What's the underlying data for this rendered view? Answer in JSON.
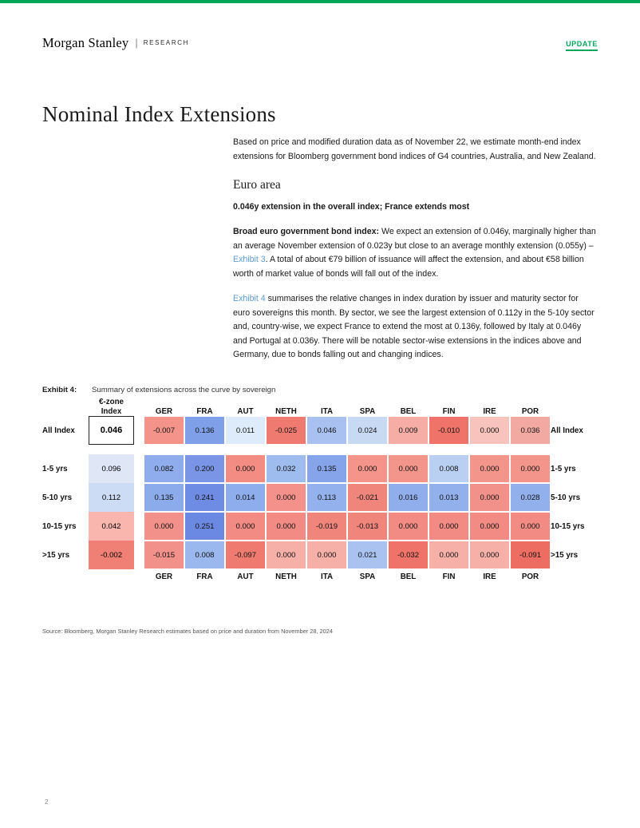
{
  "header": {
    "logo": "Morgan Stanley",
    "separator": "|",
    "research": "RESEARCH",
    "update_badge": "UPDATE"
  },
  "page_title": "Nominal Index Extensions",
  "body": {
    "intro": "Based on price and modified duration data as of November 22, we estimate month-end index extensions for Bloomberg government bond indices of G4 countries, Australia, and New Zealand.",
    "section_heading": "Euro area",
    "subheading": "0.046y extension in the overall index; France extends most",
    "para2_lead": "Broad euro government bond index:",
    "para2_a": " We expect an extension of 0.046y, marginally higher than an average November extension of 0.023y but close to an average monthly extension (0.055y) – ",
    "para2_link": "Exhibit 3",
    "para2_b": ". A total of about €79 billion of issuance will affect the extension, and about €58 billion worth of market value of bonds will fall out of the index.",
    "para3_link": "Exhibit 4",
    "para3": " summarises the relative changes in index duration by issuer and maturity sector for euro sovereigns this month. By sector, we see the largest extension of 0.112y in the 5-10y sector and, country-wise, we expect France to extend the most at 0.136y, followed by Italy at 0.046y and Portugal at 0.036y. There will be notable sector-wise extensions in the indices above and Germany, due to bonds falling out and changing indices."
  },
  "exhibit": {
    "number": "Exhibit 4:",
    "caption": "Summary of extensions across the curve by sovereign",
    "source": "Source: Bloomberg, Morgan Stanley Research estimates based on price and duration from November 28, 2024"
  },
  "chart_data": {
    "type": "heatmap",
    "title": "Summary of extensions across the curve by sovereign",
    "ezone_header_line1": "€-zone",
    "ezone_header_line2": "Index",
    "columns": [
      "GER",
      "FRA",
      "AUT",
      "NETH",
      "ITA",
      "SPA",
      "BEL",
      "FIN",
      "IRE",
      "POR"
    ],
    "rows": [
      "All Index",
      "1-5 yrs",
      "5-10 yrs",
      "10-15 yrs",
      ">15 yrs"
    ],
    "ezone_values": [
      "0.046",
      "0.096",
      "0.112",
      "0.042",
      "-0.002"
    ],
    "ezone_colors": [
      "#ffffff",
      "#dfe7f7",
      "#cddcf5",
      "#f9b6ae",
      "#f08075"
    ],
    "values": [
      [
        "-0.007",
        "0.136",
        "0.011",
        "-0.025",
        "0.046",
        "0.024",
        "0.009",
        "-0.010",
        "0.000",
        "0.036"
      ],
      [
        "0.082",
        "0.200",
        "0.000",
        "0.032",
        "0.135",
        "0.000",
        "0.000",
        "0.008",
        "0.000",
        "0.000"
      ],
      [
        "0.135",
        "0.241",
        "0.014",
        "0.000",
        "0.113",
        "-0.021",
        "0.016",
        "0.013",
        "0.000",
        "0.028"
      ],
      [
        "0.000",
        "0.251",
        "0.000",
        "0.000",
        "-0.019",
        "-0.013",
        "0.000",
        "0.000",
        "0.000",
        "0.000"
      ],
      [
        "-0.015",
        "0.008",
        "-0.097",
        "0.000",
        "0.000",
        "0.021",
        "-0.032",
        "0.000",
        "0.000",
        "-0.091"
      ]
    ],
    "colors": [
      [
        "#f4938a",
        "#7f9fe8",
        "#ddebfa",
        "#ef7b70",
        "#a8c1f0",
        "#c8d9f4",
        "#f5ada5",
        "#ef7368",
        "#f7c3bc",
        "#f1a9a2"
      ],
      [
        "#8fadec",
        "#7a95e6",
        "#f38d84",
        "#9fbcee",
        "#86a4ea",
        "#f4948b",
        "#f4958c",
        "#b9d0f2",
        "#f4958c",
        "#f4958c"
      ],
      [
        "#8cabeb",
        "#6e8ce3",
        "#8eadec",
        "#f3918a",
        "#93b1ed",
        "#f0857c",
        "#90aeec",
        "#92b0ec",
        "#f2908a",
        "#92b0ec"
      ],
      [
        "#f2908a",
        "#6b89e2",
        "#f18b84",
        "#f18b84",
        "#f0857c",
        "#f0857c",
        "#f18b84",
        "#f18b84",
        "#f18b84",
        "#f18b84"
      ],
      [
        "#f2908a",
        "#9bb8ee",
        "#ef7b70",
        "#f6b0a8",
        "#f6b0a8",
        "#a9c2f0",
        "#ef7368",
        "#f6b0a8",
        "#f6b0a8",
        "#ee6d62"
      ]
    ]
  },
  "page_number": "2"
}
